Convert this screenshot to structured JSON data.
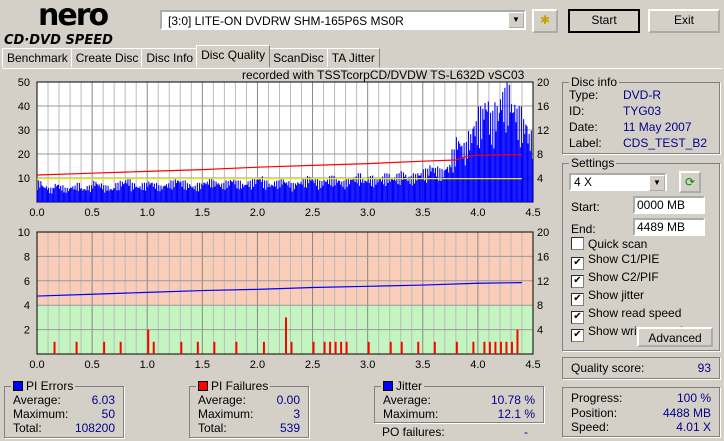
{
  "app": {
    "logo_top": "nero",
    "logo_bottom": "CD·DVD SPEED"
  },
  "toolbar": {
    "drive": "[3:0]  LITE-ON DVDRW SHM-165P6S MS0R",
    "start": "Start",
    "exit": "Exit"
  },
  "tabs": [
    {
      "label": "Benchmark"
    },
    {
      "label": "Create Disc"
    },
    {
      "label": "Disc Info"
    },
    {
      "label": "Disc Quality",
      "active": true
    },
    {
      "label": "ScanDisc"
    },
    {
      "label": "TA Jitter"
    }
  ],
  "recorded_with": "recorded with TSSTcorpCD/DVDW TS-L632D vSC03",
  "disc_info": {
    "title": "Disc info",
    "type_label": "Type:",
    "type": "DVD-R",
    "id_label": "ID:",
    "id": "TYG03",
    "date_label": "Date:",
    "date": "11 May 2007",
    "label_label": "Label:",
    "label": "CDS_TEST_B2"
  },
  "settings": {
    "title": "Settings",
    "speed": "4 X",
    "start_label": "Start:",
    "start": "0000 MB",
    "end_label": "End:",
    "end": "4489 MB",
    "checks": [
      {
        "label": "Quick scan",
        "checked": false
      },
      {
        "label": "Show C1/PIE",
        "checked": true
      },
      {
        "label": "Show C2/PIF",
        "checked": true
      },
      {
        "label": "Show jitter",
        "checked": true
      },
      {
        "label": "Show read speed",
        "checked": true
      },
      {
        "label": "Show write speed",
        "checked": true
      }
    ],
    "advanced": "Advanced"
  },
  "quality": {
    "label": "Quality score:",
    "value": "93"
  },
  "progress": {
    "progress_label": "Progress:",
    "progress": "100 %",
    "position_label": "Position:",
    "position": "4488 MB",
    "speed_label": "Speed:",
    "speed": "4.01 X"
  },
  "pi_errors": {
    "title": "PI Errors",
    "color": "#0000ff",
    "avg_label": "Average:",
    "avg": "6.03",
    "max_label": "Maximum:",
    "max": "50",
    "total_label": "Total:",
    "total": "108200"
  },
  "pi_failures": {
    "title": "PI Failures",
    "color": "#ff0000",
    "avg_label": "Average:",
    "avg": "0.00",
    "max_label": "Maximum:",
    "max": "3",
    "total_label": "Total:",
    "total": "539"
  },
  "jitter": {
    "title": "Jitter",
    "color": "#0000ff",
    "avg_label": "Average:",
    "avg": "10.78 %",
    "max_label": "Maximum:",
    "max": "12.1 %",
    "po_label": "PO failures:",
    "po": "-"
  },
  "chart_data": [
    {
      "type": "bar",
      "name": "PI errors",
      "xlim": [
        0,
        4.5
      ],
      "ylim": [
        0,
        50
      ],
      "y2lim": [
        0,
        20
      ],
      "xticks": [
        "0.0",
        "0.5",
        "1.0",
        "1.5",
        "2.0",
        "2.5",
        "3.0",
        "3.5",
        "4.0",
        "4.5"
      ],
      "yticks": [
        "10",
        "20",
        "30",
        "40",
        "50"
      ],
      "y2ticks": [
        "4",
        "8",
        "12",
        "16",
        "20"
      ],
      "step": 0.05,
      "pie": [
        9,
        7,
        6,
        8,
        7,
        6,
        7,
        8,
        6,
        7,
        9,
        8,
        7,
        6,
        8,
        9,
        10,
        8,
        7,
        8,
        9,
        8,
        7,
        8,
        9,
        10,
        9,
        8,
        7,
        8,
        9,
        10,
        9,
        8,
        9,
        10,
        9,
        8,
        9,
        10,
        11,
        9,
        8,
        9,
        10,
        9,
        8,
        9,
        10,
        11,
        10,
        9,
        10,
        11,
        10,
        9,
        10,
        11,
        12,
        10,
        11,
        10,
        11,
        12,
        11,
        12,
        13,
        11,
        12,
        13,
        14,
        16,
        15,
        14,
        16,
        22,
        28,
        25,
        30,
        35,
        40,
        45,
        38,
        42,
        48,
        50,
        44,
        40,
        36,
        30
      ],
      "read_speed": {
        "x": [
          0,
          0.5,
          1,
          1.5,
          2,
          2.5,
          3,
          3.5,
          3.8,
          3.9,
          4.0,
          4.4
        ],
        "y": [
          4.5,
          4.8,
          5.1,
          5.4,
          5.8,
          6.1,
          6.4,
          6.8,
          7.0,
          7.6,
          7.8,
          7.9
        ]
      },
      "write_speed": {
        "x": [
          0,
          4.4
        ],
        "y": [
          3.9,
          3.9
        ]
      }
    },
    {
      "type": "line",
      "name": "Jitter / PI failures",
      "xlim": [
        0,
        4.5
      ],
      "ylim": [
        0,
        10
      ],
      "y2lim": [
        0,
        20
      ],
      "xticks": [
        "0.0",
        "0.5",
        "1.0",
        "1.5",
        "2.0",
        "2.5",
        "3.0",
        "3.5",
        "4.0",
        "4.5"
      ],
      "yticks": [
        "2",
        "4",
        "6",
        "8",
        "10"
      ],
      "y2ticks": [
        "4",
        "8",
        "12",
        "16",
        "20"
      ],
      "jitter": {
        "x": [
          0,
          0.5,
          1,
          1.5,
          2,
          2.5,
          3,
          3.5,
          4,
          4.4
        ],
        "y": [
          9.5,
          9.8,
          10.1,
          10.4,
          10.6,
          10.9,
          11.1,
          11.3,
          11.6,
          11.7
        ]
      },
      "pif": {
        "x": [
          0.15,
          0.35,
          0.6,
          0.75,
          1.0,
          1.05,
          1.3,
          1.45,
          1.6,
          1.8,
          2.05,
          2.25,
          2.3,
          2.5,
          2.6,
          2.65,
          2.7,
          2.75,
          2.8,
          3.0,
          3.2,
          3.3,
          3.45,
          3.6,
          3.8,
          3.95,
          4.05,
          4.1,
          4.15,
          4.2,
          4.25,
          4.3,
          4.35
        ],
        "y": [
          1,
          1,
          1,
          1,
          2,
          1,
          1,
          1,
          1,
          1,
          1,
          3,
          1,
          1,
          1,
          1,
          1,
          1,
          1,
          1,
          1,
          1,
          1,
          1,
          1,
          1,
          1,
          1,
          1,
          1,
          1,
          1,
          2
        ]
      }
    }
  ]
}
